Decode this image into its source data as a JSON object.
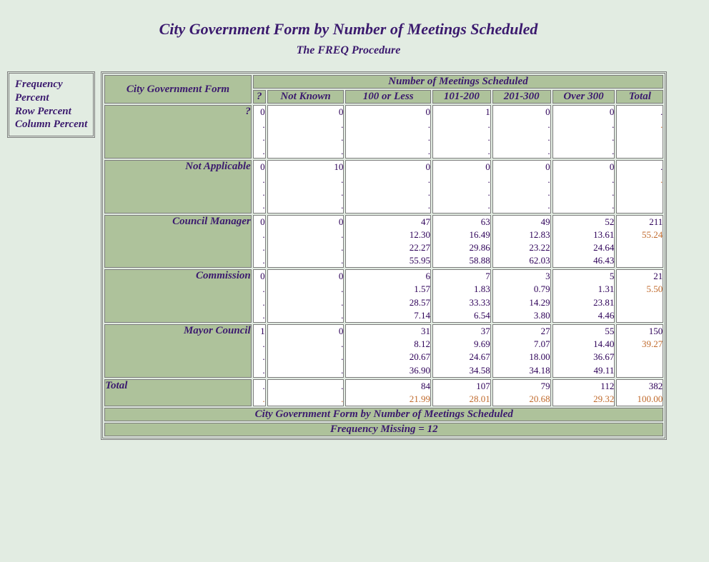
{
  "title": "City Government Form by Number of Meetings Scheduled",
  "subtitle": "The FREQ Procedure",
  "legend": {
    "l1": "Frequency",
    "l2": "Percent",
    "l3": "Row Percent",
    "l4": "Column Percent"
  },
  "headers": {
    "row_var": "City Government Form",
    "col_var": "Number of Meetings Scheduled",
    "c_q": "?",
    "c_nk": "Not Known",
    "c_100": "100 or Less",
    "c_101": "101-200",
    "c_201": "201-300",
    "c_300": "Over 300",
    "c_tot": "Total"
  },
  "rows": {
    "r_q": {
      "label": "?",
      "c_q": {
        "a": "0",
        "b": ".",
        "c": ".",
        "d": "."
      },
      "c_nk": {
        "a": "0",
        "b": ".",
        "c": ".",
        "d": "."
      },
      "c_100": {
        "a": "0",
        "b": ".",
        "c": ".",
        "d": "."
      },
      "c_101": {
        "a": "1",
        "b": ".",
        "c": ".",
        "d": "."
      },
      "c_201": {
        "a": "0",
        "b": ".",
        "c": ".",
        "d": "."
      },
      "c_300": {
        "a": "0",
        "b": ".",
        "c": ".",
        "d": "."
      },
      "c_tot": {
        "a": ".",
        "b": "."
      }
    },
    "r_na": {
      "label": "Not Applicable",
      "c_q": {
        "a": "0",
        "b": ".",
        "c": ".",
        "d": "."
      },
      "c_nk": {
        "a": "10",
        "b": ".",
        "c": ".",
        "d": "."
      },
      "c_100": {
        "a": "0",
        "b": ".",
        "c": ".",
        "d": "."
      },
      "c_101": {
        "a": "0",
        "b": ".",
        "c": ".",
        "d": "."
      },
      "c_201": {
        "a": "0",
        "b": ".",
        "c": ".",
        "d": "."
      },
      "c_300": {
        "a": "0",
        "b": ".",
        "c": ".",
        "d": "."
      },
      "c_tot": {
        "a": ".",
        "b": "."
      }
    },
    "r_cm": {
      "label": "Council Manager",
      "c_q": {
        "a": "0",
        "b": ".",
        "c": ".",
        "d": "."
      },
      "c_nk": {
        "a": "0",
        "b": ".",
        "c": ".",
        "d": "."
      },
      "c_100": {
        "a": "47",
        "b": "12.30",
        "c": "22.27",
        "d": "55.95"
      },
      "c_101": {
        "a": "63",
        "b": "16.49",
        "c": "29.86",
        "d": "58.88"
      },
      "c_201": {
        "a": "49",
        "b": "12.83",
        "c": "23.22",
        "d": "62.03"
      },
      "c_300": {
        "a": "52",
        "b": "13.61",
        "c": "24.64",
        "d": "46.43"
      },
      "c_tot": {
        "a": "211",
        "b": "55.24"
      }
    },
    "r_co": {
      "label": "Commission",
      "c_q": {
        "a": "0",
        "b": ".",
        "c": ".",
        "d": "."
      },
      "c_nk": {
        "a": "0",
        "b": ".",
        "c": ".",
        "d": "."
      },
      "c_100": {
        "a": "6",
        "b": "1.57",
        "c": "28.57",
        "d": "7.14"
      },
      "c_101": {
        "a": "7",
        "b": "1.83",
        "c": "33.33",
        "d": "6.54"
      },
      "c_201": {
        "a": "3",
        "b": "0.79",
        "c": "14.29",
        "d": "3.80"
      },
      "c_300": {
        "a": "5",
        "b": "1.31",
        "c": "23.81",
        "d": "4.46"
      },
      "c_tot": {
        "a": "21",
        "b": "5.50"
      }
    },
    "r_mc": {
      "label": "Mayor Council",
      "c_q": {
        "a": "1",
        "b": ".",
        "c": ".",
        "d": "."
      },
      "c_nk": {
        "a": "0",
        "b": ".",
        "c": ".",
        "d": "."
      },
      "c_100": {
        "a": "31",
        "b": "8.12",
        "c": "20.67",
        "d": "36.90"
      },
      "c_101": {
        "a": "37",
        "b": "9.69",
        "c": "24.67",
        "d": "34.58"
      },
      "c_201": {
        "a": "27",
        "b": "7.07",
        "c": "18.00",
        "d": "34.18"
      },
      "c_300": {
        "a": "55",
        "b": "14.40",
        "c": "36.67",
        "d": "49.11"
      },
      "c_tot": {
        "a": "150",
        "b": "39.27"
      }
    },
    "r_tot": {
      "label": "Total",
      "c_q": {
        "a": ".",
        "b": "."
      },
      "c_nk": {
        "a": ".",
        "b": "."
      },
      "c_100": {
        "a": "84",
        "b": "21.99"
      },
      "c_101": {
        "a": "107",
        "b": "28.01"
      },
      "c_201": {
        "a": "79",
        "b": "20.68"
      },
      "c_300": {
        "a": "112",
        "b": "29.32"
      },
      "c_tot": {
        "a": "382",
        "b": "100.00"
      }
    }
  },
  "footer1": "City Government Form by Number of Meetings Scheduled",
  "footer2": "Frequency Missing = 12"
}
